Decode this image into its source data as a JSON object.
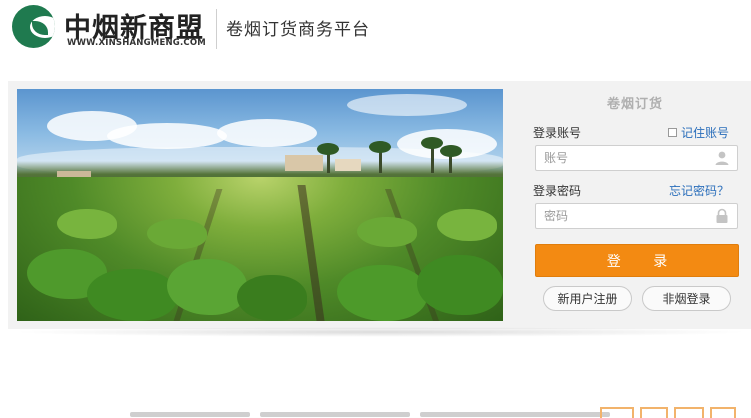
{
  "header": {
    "brand_name": "中烟新商盟",
    "brand_url": "WWW.XINSHANGMENG.COM",
    "platform_title": "卷烟订货商务平台"
  },
  "login": {
    "form_title": "卷烟订货",
    "account_label": "登录账号",
    "remember_label": "记住账号",
    "remember_checked": false,
    "account_placeholder": "账号",
    "account_value": "",
    "password_label": "登录密码",
    "forgot_label": "忘记密码？",
    "password_placeholder": "密码",
    "password_value": "",
    "login_button": "登 录",
    "register_button": "新用户注册",
    "non_tobacco_button": "非烟登录"
  },
  "colors": {
    "brand_green": "#1f7a4f",
    "accent_orange": "#f38a12",
    "link_blue": "#2a6ebb",
    "panel_bg": "#f2f2f2"
  },
  "icons": {
    "user_icon": "user-icon",
    "lock_icon": "lock-icon"
  }
}
